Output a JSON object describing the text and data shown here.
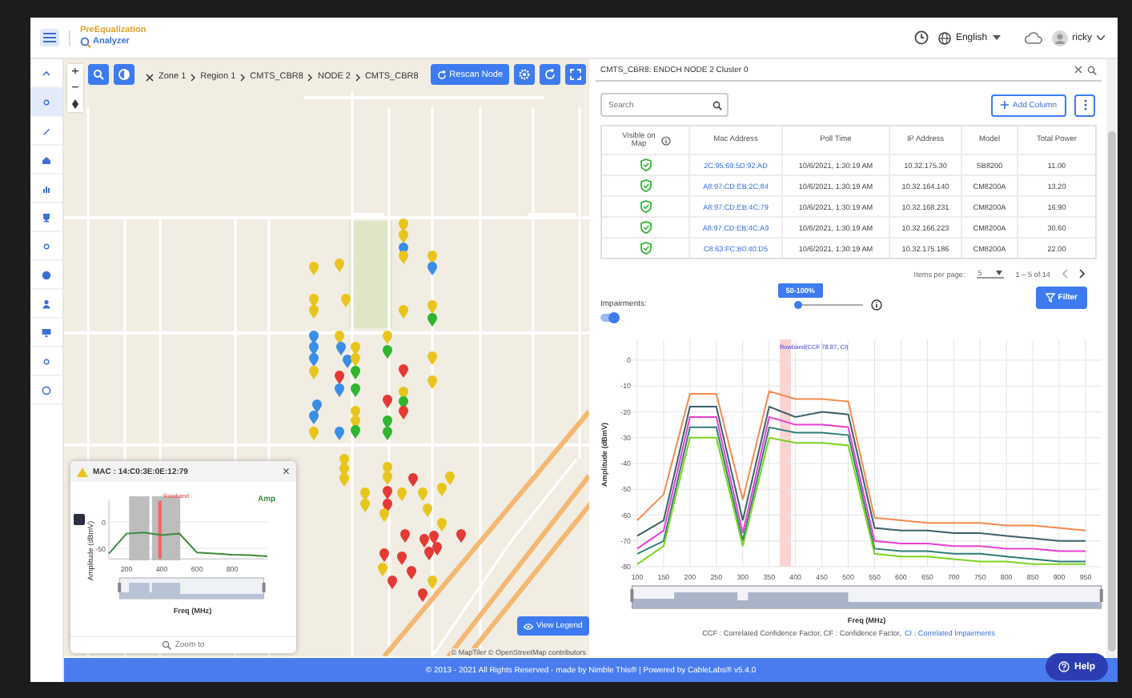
{
  "header": {
    "logo_line1": "PreEqualization",
    "logo_line2": "Analyzer",
    "language": "English",
    "user": "ricky"
  },
  "sidebar": {
    "items": [
      {
        "selected": false
      },
      {
        "selected": true
      },
      {
        "selected": false
      },
      {
        "selected": false
      },
      {
        "selected": false
      },
      {
        "selected": false
      },
      {
        "selected": false
      },
      {
        "selected": false
      },
      {
        "selected": false
      },
      {
        "selected": false
      },
      {
        "selected": false
      },
      {
        "selected": false
      }
    ]
  },
  "map": {
    "zoom_in": "+",
    "zoom_out": "−",
    "breadcrumb": [
      "Zone 1",
      "Region 1",
      "CMTS_CBR8",
      "NODE 2",
      "CMTS_CBR8"
    ],
    "rescan_button": "Rescan Node",
    "view_legend_button": "View Legend",
    "attribution": "© MapTiler © OpenStreetMap contributors",
    "pins": [
      {
        "color": "#e8c51c"
      },
      {
        "color": "#e8c51c"
      },
      {
        "color": "#3a8ee6"
      },
      {
        "color": "#e8c51c"
      },
      {
        "color": "#e8c51c"
      },
      {
        "color": "#3a8ee6"
      },
      {
        "color": "#e8c51c"
      },
      {
        "color": "#e8c51c"
      },
      {
        "color": "#e8c51c"
      },
      {
        "color": "#e8c51c"
      },
      {
        "color": "#e8c51c"
      },
      {
        "color": "#e8c51c"
      },
      {
        "color": "#e8c51c"
      },
      {
        "color": "#2fb52f"
      },
      {
        "color": "#3a8ee6"
      },
      {
        "color": "#3a8ee6"
      },
      {
        "color": "#3a8ee6"
      },
      {
        "color": "#e8c51c"
      },
      {
        "color": "#e8c51c"
      },
      {
        "color": "#3a8ee6"
      },
      {
        "color": "#3a8ee6"
      },
      {
        "color": "#e8c51c"
      },
      {
        "color": "#e8c51c"
      },
      {
        "color": "#2fb52f"
      },
      {
        "color": "#e8c51c"
      },
      {
        "color": "#2fb52f"
      },
      {
        "color": "#e53935"
      },
      {
        "color": "#e8c51c"
      },
      {
        "color": "#e8c51c"
      },
      {
        "color": "#e53935"
      },
      {
        "color": "#3a8ee6"
      },
      {
        "color": "#2fb52f"
      },
      {
        "color": "#e8c51c"
      },
      {
        "color": "#e53935"
      },
      {
        "color": "#2fb52f"
      },
      {
        "color": "#e53935"
      },
      {
        "color": "#3a8ee6"
      },
      {
        "color": "#3a8ee6"
      },
      {
        "color": "#e8c51c"
      },
      {
        "color": "#e8c51c"
      },
      {
        "color": "#2fb52f"
      },
      {
        "color": "#2fb52f"
      },
      {
        "color": "#2fb52f"
      },
      {
        "color": "#e8c51c"
      },
      {
        "color": "#3a8ee6"
      },
      {
        "color": "#e8c51c"
      },
      {
        "color": "#e8c51c"
      },
      {
        "color": "#e8c51c"
      },
      {
        "color": "#e8c51c"
      },
      {
        "color": "#e8c51c"
      },
      {
        "color": "#e8c51c"
      },
      {
        "color": "#e8c51c"
      },
      {
        "color": "#e53935"
      },
      {
        "color": "#e8c51c"
      },
      {
        "color": "#e8c51c"
      },
      {
        "color": "#e8c51c"
      },
      {
        "color": "#e8c51c"
      },
      {
        "color": "#e53935"
      },
      {
        "color": "#e53935"
      },
      {
        "color": "#e8c51c"
      },
      {
        "color": "#e8c51c"
      },
      {
        "color": "#e8c51c"
      },
      {
        "color": "#e53935"
      },
      {
        "color": "#e53935"
      },
      {
        "color": "#e53935"
      },
      {
        "color": "#e53935"
      },
      {
        "color": "#e53935"
      },
      {
        "color": "#e53935"
      },
      {
        "color": "#e53935"
      },
      {
        "color": "#e8c51c"
      },
      {
        "color": "#e53935"
      },
      {
        "color": "#e53935"
      },
      {
        "color": "#e8c51c"
      },
      {
        "color": "#e53935"
      },
      {
        "color": "#e53935"
      }
    ]
  },
  "popup": {
    "title": "MAC : 14:C0:3E:0E:12:79",
    "close": "×",
    "zoom_to": "Zoom to",
    "chart_data": {
      "type": "line",
      "xlabel": "Freq (MHz)",
      "ylabel": "Amplitude (dBmV)",
      "x": [
        100,
        200,
        300,
        400,
        500,
        600,
        700,
        800,
        900,
        1000
      ],
      "series": [
        {
          "name": "Amp",
          "color": "#3c8a3c",
          "values": [
            -60,
            -22,
            -20,
            -25,
            -22,
            -58,
            -60,
            -62,
            -63,
            -65
          ]
        }
      ],
      "xlim": [
        100,
        1000
      ],
      "ylim": [
        -70,
        40
      ],
      "xticks": [
        200,
        400,
        600,
        800
      ],
      "yticks": [
        0,
        -50
      ],
      "annotations": [
        "Rowband"
      ]
    }
  },
  "device_panel": {
    "cluster_field": {
      "value": "CMTS_CBR8: ENDCH NODE 2 Cluster 0"
    },
    "search": {
      "placeholder": "Search"
    },
    "add_column_button": "Add Column",
    "table": {
      "columns": [
        "Visible on Map",
        "Mac Address",
        "Poll Time",
        "IP Address",
        "Model",
        "Total Power"
      ],
      "rows": [
        {
          "visible": true,
          "cells": [
            "",
            "2C:95:69:5D:92:AD",
            "10/6/2021, 1:30:19 AM",
            "10.32.175.30",
            "SB8200",
            "11.00"
          ]
        },
        {
          "visible": true,
          "cells": [
            "",
            "A8:97:CD:EB:2C:84",
            "10/6/2021, 1:30:19 AM",
            "10.32.164.140",
            "CM8200A",
            "13.20"
          ]
        },
        {
          "visible": true,
          "cells": [
            "",
            "A8:97:CD:EB:4C:79",
            "10/6/2021, 1:30:19 AM",
            "10.32.168.231",
            "CM8200A",
            "16.90"
          ]
        },
        {
          "visible": true,
          "cells": [
            "",
            "A8:97:CD:EB:4C:A9",
            "10/6/2021, 1:30:19 AM",
            "10.32.166.223",
            "CM8200A",
            "30.60"
          ]
        },
        {
          "visible": true,
          "cells": [
            "",
            "C8:63:FC:B0:40:D5",
            "10/6/2021, 1:30:19 AM",
            "10.32.175.186",
            "CM8200A",
            "22.00"
          ]
        }
      ]
    },
    "pagination": {
      "label": "Items per page:",
      "page_size": "5",
      "range": "1 – 5 of 14"
    }
  },
  "impairments": {
    "label": "Impairments:",
    "on": true,
    "slider_label": "50-100%",
    "level": 0,
    "filter_button": "Filter"
  },
  "spectrum": {
    "chart_data": {
      "type": "line",
      "xlabel": "Freq (MHz)",
      "ylabel": "Amplitude (dBmV)",
      "x": [
        100,
        150,
        200,
        250,
        300,
        350,
        400,
        450,
        500,
        550,
        600,
        650,
        700,
        750,
        800,
        850,
        900,
        950
      ],
      "series": [
        {
          "color": "#f5894f",
          "values": [
            -62,
            -52,
            -13,
            -13,
            -54,
            -12,
            -15,
            -15,
            -16,
            -61,
            -62,
            -63,
            -63,
            -63,
            -64,
            -64,
            -65,
            -66
          ]
        },
        {
          "color": "#3e5f6b",
          "values": [
            -68,
            -62,
            -18,
            -18,
            -62,
            -18,
            -22,
            -20,
            -21,
            -65,
            -66,
            -66,
            -67,
            -67,
            -68,
            -69,
            -70,
            -70
          ]
        },
        {
          "color": "#e83fd2",
          "values": [
            -73,
            -66,
            -22,
            -22,
            -67,
            -22,
            -25,
            -25,
            -26,
            -70,
            -71,
            -71,
            -72,
            -72,
            -73,
            -73,
            -74,
            -74
          ]
        },
        {
          "color": "#2e7d7a",
          "values": [
            -75,
            -70,
            -26,
            -26,
            -70,
            -26,
            -28,
            -28,
            -29,
            -73,
            -74,
            -74,
            -75,
            -75,
            -76,
            -77,
            -78,
            -78
          ]
        },
        {
          "color": "#7ed321",
          "values": [
            -79,
            -72,
            -30,
            -30,
            -72,
            -30,
            -32,
            -32,
            -33,
            -75,
            -76,
            -76,
            -77,
            -78,
            -78,
            -79,
            -79,
            -79
          ]
        }
      ],
      "xlim": [
        90,
        980
      ],
      "ylim": [
        -80,
        8
      ],
      "xticks": [
        100,
        150,
        200,
        250,
        300,
        350,
        400,
        450,
        500,
        550,
        600,
        650,
        700,
        750,
        800,
        850,
        900,
        950
      ],
      "yticks": [
        0,
        -10,
        -20,
        -30,
        -40,
        -50,
        -60,
        -70,
        -80
      ],
      "grid": true,
      "annotations": [
        "Rowband(CCF 78.87, CI)"
      ]
    },
    "footnote": "CCF : Correlated Confidence Factor, CF : Confidence Factor,",
    "footnote_link": "CI : Correlated Impairments"
  },
  "footer": {
    "text": "© 2013 - 2021 All Rights Reserved - made by Nimble This® | Powered by CableLabs® v5.4.0"
  },
  "help_button": "Help"
}
